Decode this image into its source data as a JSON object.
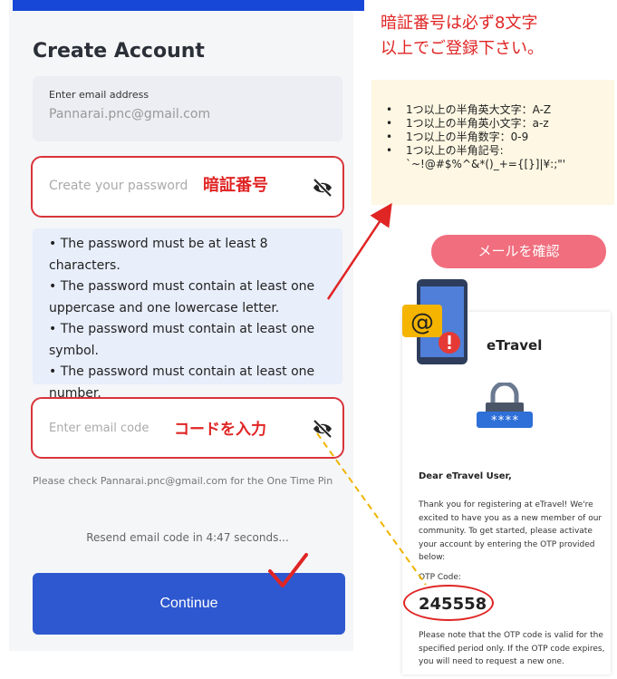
{
  "form": {
    "title": "Create Account",
    "email_label": "Enter email address",
    "email_value": "Pannarai.pnc@gmail.com",
    "password_placeholder": "Create your password",
    "password_note": "暗証番号",
    "rules": [
      "•  The password must be at least 8 characters.",
      "•  The password must contain at least one uppercase and one lowercase letter.",
      "•  The password must contain at least one symbol.",
      "•  The password must contain at least one number."
    ],
    "code_placeholder": "Enter email code",
    "code_note": "コードを入力",
    "check_message": "Please check Pannarai.pnc@gmail.com for the One Time Pin",
    "resend_text": "Resend email code in 4:47 seconds...",
    "continue_label": "Continue"
  },
  "annotations": {
    "heading_line1": "暗証番号は必ず8文字",
    "heading_line2": "以上でご登録下さい。",
    "requirements": [
      "1つ以上の半角英大文字：A-Z",
      "1つ以上の半角英小文字：a-z",
      "1つ以上の半角数字：0-9",
      "1つ以上の半角記号:"
    ],
    "symbols": "`~!@#$%^&*()_+={[}]|¥:;\"'",
    "check_mail_label": "メールを確認"
  },
  "email_preview": {
    "brand": "eTravel",
    "greeting": "Dear eTravel User,",
    "body": "Thank you for registering at eTravel! We're excited to have you as a new member of our community. To get started, please activate your account by entering the OTP provided below:",
    "otp_label": "OTP Code:",
    "otp_code": "245558",
    "footer": "Please note that the OTP code is valid for the specified period only. If the OTP code expires, you will need to request a new one."
  },
  "colors": {
    "accent_blue": "#2e58d0",
    "annotation_red": "#e02525",
    "pink_button": "#f06e7e",
    "note_bg": "#fdf7e3"
  }
}
